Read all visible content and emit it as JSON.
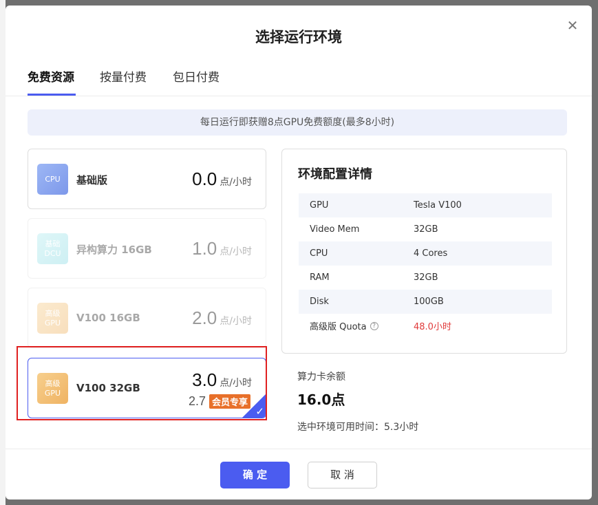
{
  "modal": {
    "title": "选择运行环境",
    "close_icon": "close-icon"
  },
  "tabs": [
    {
      "label": "免费资源",
      "active": true
    },
    {
      "label": "按量付费",
      "active": false
    },
    {
      "label": "包日付费",
      "active": false
    }
  ],
  "banner": "每日运行即获赠8点GPU免费额度(最多8小时)",
  "options": [
    {
      "chip": "CPU",
      "name": "基础版",
      "price": "0.0",
      "unit": "点/小时",
      "enabled": true
    },
    {
      "chip": "基础\nDCU",
      "name": "异构算力 16GB",
      "price": "1.0",
      "unit": "点/小时",
      "enabled": false
    },
    {
      "chip": "高级\nGPU",
      "name": "V100 16GB",
      "price": "2.0",
      "unit": "点/小时",
      "enabled": false
    },
    {
      "chip": "高级\nGPU",
      "name": "V100 32GB",
      "price": "3.0",
      "unit": "点/小时",
      "enabled": true,
      "selected": true,
      "member_price": "2.7",
      "member_badge": "会员专享"
    }
  ],
  "details": {
    "title": "环境配置详情",
    "rows": [
      {
        "key": "GPU",
        "value": "Tesla V100"
      },
      {
        "key": "Video Mem",
        "value": "32GB"
      },
      {
        "key": "CPU",
        "value": "4 Cores"
      },
      {
        "key": "RAM",
        "value": "32GB"
      },
      {
        "key": "Disk",
        "value": "100GB"
      },
      {
        "key": "高级版 Quota",
        "value": "48.0小时",
        "help": "?",
        "value_color": "#e03a3a"
      }
    ]
  },
  "balance": {
    "label": "算力卡余额",
    "value": "16.0点",
    "available_time": "选中环境可用时间：5.3小时"
  },
  "buttons": {
    "confirm": "确 定",
    "cancel": "取 消"
  },
  "colors": {
    "accent": "#4b5cf0",
    "member_badge": "#e8702a",
    "quota_red": "#e03a3a",
    "highlight_red": "#e02020"
  },
  "icons": {
    "check": "check-icon",
    "help": "help-icon"
  }
}
